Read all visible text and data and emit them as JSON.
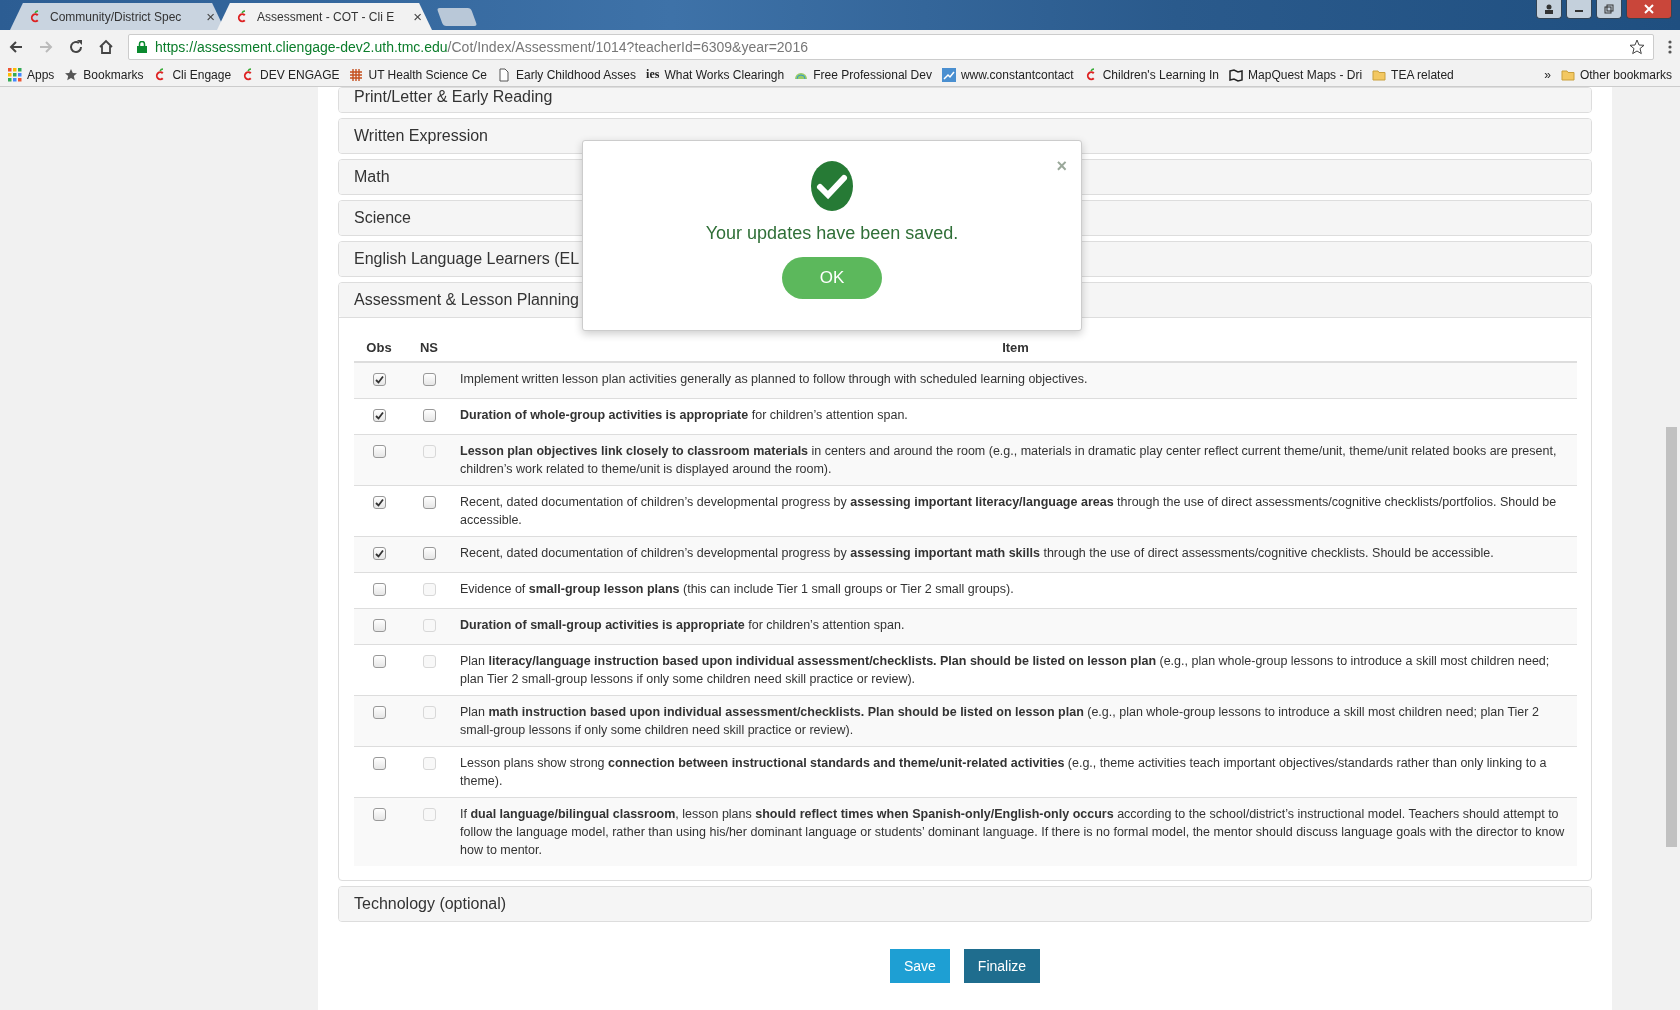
{
  "browser": {
    "tabs": [
      {
        "title": "Community/District Spec",
        "selected": false,
        "close": "×"
      },
      {
        "title": "Assessment - COT - Cli E",
        "selected": true,
        "close": "×"
      }
    ],
    "address_host": "https://assessment.cliengage-dev2.uth.tmc.edu",
    "address_path": "/Cot/Index/Assessment/1014?teacherId=6309&year=2016",
    "bookmarks": [
      {
        "kind": "apps",
        "label": "Apps"
      },
      {
        "kind": "star",
        "label": "Bookmarks"
      },
      {
        "kind": "apple",
        "label": "Cli Engage"
      },
      {
        "kind": "apple",
        "label": "DEV ENGAGE"
      },
      {
        "kind": "grid",
        "label": "UT Health Science Ce"
      },
      {
        "kind": "page",
        "label": "Early Childhood Asses"
      },
      {
        "kind": "ies",
        "badge": "ies",
        "label": "What Works Clearingh"
      },
      {
        "kind": "web",
        "label": "Free Professional Dev"
      },
      {
        "kind": "chart",
        "label": "www.constantcontact"
      },
      {
        "kind": "apple",
        "label": "Children's Learning In"
      },
      {
        "kind": "map",
        "label": "MapQuest Maps - Dri"
      },
      {
        "kind": "folder",
        "label": "TEA related"
      }
    ],
    "overflow": "»",
    "other_bookmarks": "Other bookmarks"
  },
  "sections": [
    {
      "title": "Print/Letter & Early Reading",
      "expanded": false
    },
    {
      "title": "Written Expression",
      "expanded": false
    },
    {
      "title": "Math",
      "expanded": false
    },
    {
      "title": "Science",
      "expanded": false
    },
    {
      "title": "English Language Learners (EL",
      "expanded": false
    },
    {
      "title": "Assessment & Lesson Planning",
      "expanded": true
    },
    {
      "title": "Technology (optional)",
      "expanded": false
    }
  ],
  "table": {
    "columns": [
      "Obs",
      "NS",
      "Item"
    ],
    "rows": [
      {
        "obs": true,
        "ns": false,
        "ns_disabled": false,
        "text": "Implement written lesson plan activities generally as planned to follow through with scheduled learning objectives."
      },
      {
        "obs": true,
        "ns": false,
        "ns_disabled": false,
        "text": "**Duration of whole-group activities is appropriate** for children’s attention span."
      },
      {
        "obs": false,
        "ns": false,
        "ns_disabled": true,
        "text": "**Lesson plan objectives link closely to classroom materials** in centers and around the room (e.g., materials in dramatic play center reflect current theme/unit, theme/unit related books are present, children’s work related to theme/unit is displayed around the room)."
      },
      {
        "obs": true,
        "ns": false,
        "ns_disabled": false,
        "text": "Recent, dated documentation of children’s developmental progress by **assessing important literacy/language areas** through the use of direct assessments/cognitive checklists/portfolios. Should be accessible."
      },
      {
        "obs": true,
        "ns": false,
        "ns_disabled": false,
        "text": "Recent, dated documentation of children’s developmental progress by **assessing important math skills** through the use of direct assessments/cognitive checklists. Should be accessible."
      },
      {
        "obs": false,
        "ns": false,
        "ns_disabled": true,
        "text": "Evidence of **small-group lesson plans** (this can include Tier 1 small groups or Tier 2 small groups)."
      },
      {
        "obs": false,
        "ns": false,
        "ns_disabled": true,
        "text": "**Duration of small-group activities is appropriate** for children’s attention span."
      },
      {
        "obs": false,
        "ns": false,
        "ns_disabled": true,
        "text": "Plan **literacy/language instruction based upon individual assessment/checklists.  Plan should be listed on lesson plan** (e.g., plan whole-group lessons to introduce a skill most children need; plan Tier 2 small-group lessons if only some children need skill practice or review)."
      },
      {
        "obs": false,
        "ns": false,
        "ns_disabled": true,
        "text": "Plan **math instruction based upon individual assessment/checklists.  Plan should be listed on lesson plan** (e.g., plan whole-group lessons to introduce a skill most children need; plan Tier 2 small-group lessons if only some children need skill practice or review)."
      },
      {
        "obs": false,
        "ns": false,
        "ns_disabled": true,
        "text": "Lesson plans show strong **connection between instructional standards and theme/unit-related activities** (e.g., theme activities teach important objectives/standards rather than only linking to a theme)."
      },
      {
        "obs": false,
        "ns": false,
        "ns_disabled": true,
        "text": "If **dual language/bilingual classroom**, lesson plans **should reflect times when Spanish-only/English-only occurs** according to the school/district’s instructional model. Teachers should attempt to follow the language model, rather than using his/her dominant language or students’ dominant language. If there is no formal model, the mentor should discuss language goals with the director to know how to mentor."
      }
    ]
  },
  "buttons": [
    {
      "label": "Save",
      "kind": "primary"
    },
    {
      "label": "Finalize",
      "kind": "dark"
    }
  ],
  "dialog": {
    "message": "Your updates have been saved.",
    "close": "×",
    "button": "OK"
  }
}
